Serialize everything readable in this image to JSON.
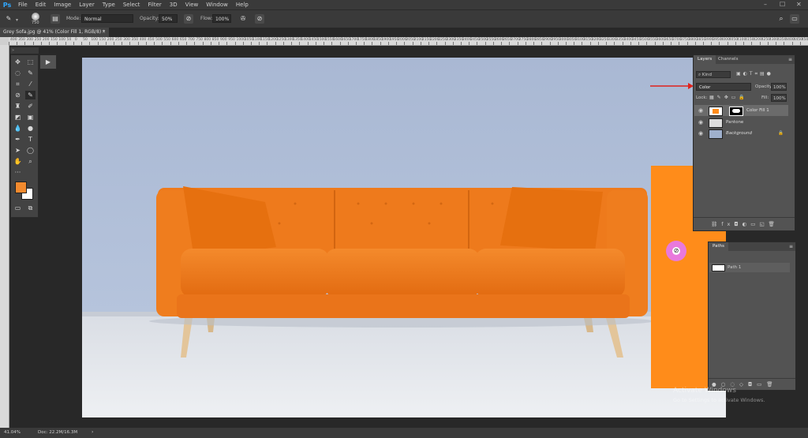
{
  "app": {
    "logo": "Ps"
  },
  "menu": [
    "File",
    "Edit",
    "Image",
    "Layer",
    "Type",
    "Select",
    "Filter",
    "3D",
    "View",
    "Window",
    "Help"
  ],
  "window_controls": {
    "minimize": "–",
    "maximize": "☐",
    "close": "✕"
  },
  "options_bar": {
    "brush_size": "750",
    "mode_label": "Mode:",
    "mode_value": "Normal",
    "opacity_label": "Opacity:",
    "opacity_value": "50%",
    "flow_label": "Flow:",
    "flow_value": "100%"
  },
  "document_tab": {
    "title": "Grey Sofa.jpg @ 41% (Color Fill 1, RGB/8) *",
    "close": "×"
  },
  "ruler_ticks": [
    "400",
    "350",
    "300",
    "250",
    "200",
    "150",
    "100",
    "50",
    "0",
    "50",
    "100",
    "150",
    "200",
    "250",
    "300",
    "350",
    "400",
    "450",
    "500",
    "550",
    "600",
    "650",
    "700",
    "750",
    "800",
    "850",
    "900",
    "950",
    "1000",
    "1050",
    "1100",
    "1150",
    "1200",
    "1250",
    "1300",
    "1350",
    "1400",
    "1450",
    "1500",
    "1550",
    "1600",
    "1650",
    "1700",
    "1750",
    "1800",
    "1850",
    "1900",
    "1950",
    "2000",
    "2050",
    "2100",
    "2150",
    "2200",
    "2250",
    "2300",
    "2350",
    "2400",
    "2450",
    "2500",
    "2550",
    "2600",
    "2650",
    "2700",
    "2750",
    "2800",
    "2850",
    "2900",
    "2950",
    "3000",
    "3050",
    "3100",
    "3150",
    "3200",
    "3250",
    "3300",
    "3350",
    "3400",
    "3450",
    "3500",
    "3550",
    "3600",
    "3650",
    "3700",
    "3750",
    "3800",
    "3850",
    "3900",
    "3950",
    "4000",
    "4050",
    "4100",
    "4150",
    "4200",
    "4250",
    "4300",
    "4350",
    "4400",
    "4450",
    "4500"
  ],
  "layers_panel": {
    "tabs": [
      "Layers",
      "Channels"
    ],
    "filter_kind": "Kind",
    "blend_mode": "Color",
    "opacity_label": "Opacity:",
    "opacity_value": "100%",
    "lock_label": "Lock:",
    "fill_label": "Fill:",
    "fill_value": "100%",
    "layers": [
      {
        "name": "Color Fill 1",
        "selected": true
      },
      {
        "name": "Pantone",
        "selected": false
      },
      {
        "name": "Background",
        "selected": false
      }
    ],
    "colors": {
      "fill": "#ff8c1a",
      "accent_arrow": "#e0231c"
    }
  },
  "paths_panel": {
    "tab": "Paths",
    "paths": [
      {
        "name": "Path 1"
      }
    ]
  },
  "watermark": {
    "line1": "Activate Windows",
    "line2": "Go to Settings to activate Windows."
  },
  "status_bar": {
    "zoom": "41.04%",
    "doc": "Doc: 22.2M/16.3M"
  },
  "colors": {
    "foreground": "#f28a2e",
    "background": "#ffffff",
    "sofa": "#f0781a",
    "wall": "#a9b9d6"
  }
}
